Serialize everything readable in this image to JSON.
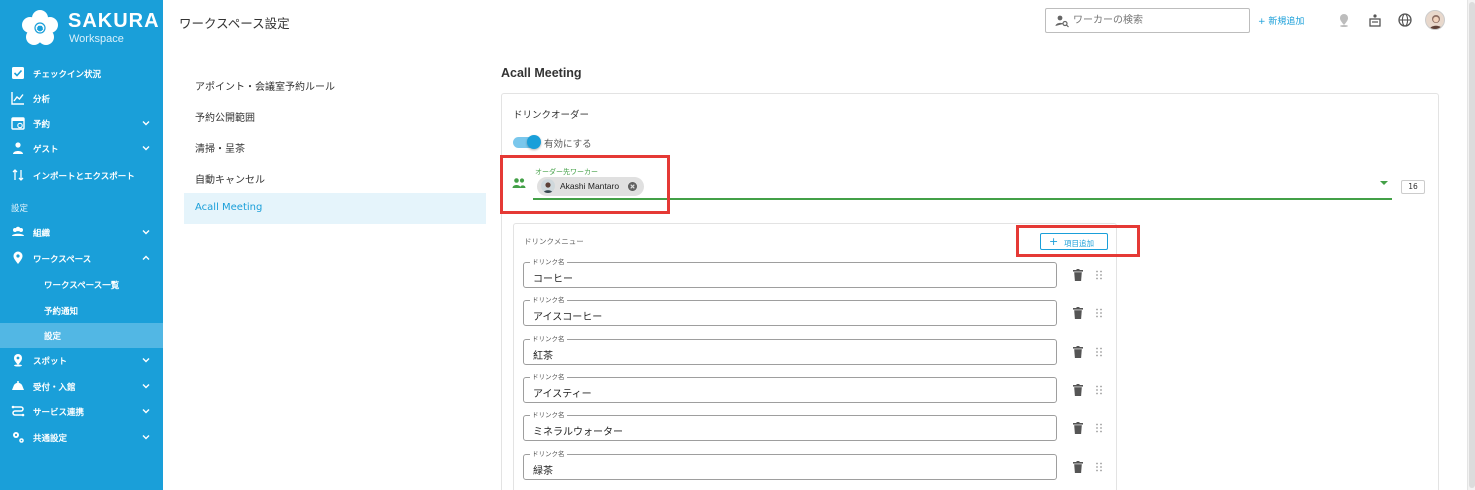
{
  "brand": {
    "name": "SAKURA",
    "sub": "Workspace"
  },
  "header": {
    "title": "ワークスペース設定",
    "search_placeholder": "ワーカーの検索",
    "new_add": "+ 新規追加"
  },
  "sidebar": {
    "items": [
      {
        "label": "チェックイン状況",
        "icon": "checkbox-icon"
      },
      {
        "label": "分析",
        "icon": "chart-icon"
      },
      {
        "label": "予約",
        "icon": "calendar-icon"
      },
      {
        "label": "ゲスト",
        "icon": "guest-icon"
      },
      {
        "label": "インポートとエクスポート",
        "icon": "import-export-icon"
      }
    ],
    "section_label": "設定",
    "settings_items": [
      {
        "label": "組織",
        "icon": "people-icon"
      },
      {
        "label": "ワークスペース",
        "icon": "location-pin-icon"
      }
    ],
    "sub_items": [
      {
        "label": "ワークスペース一覧"
      },
      {
        "label": "予約通知"
      },
      {
        "label": "設定"
      }
    ],
    "more_items": [
      {
        "label": "スポット",
        "icon": "spot-icon"
      },
      {
        "label": "受付・入館",
        "icon": "reception-icon"
      },
      {
        "label": "サービス連携",
        "icon": "integration-icon"
      },
      {
        "label": "共通設定",
        "icon": "gear-icon"
      }
    ]
  },
  "settings_menu": [
    {
      "label": "アポイント・会議室予約ルール"
    },
    {
      "label": "予約公開範囲"
    },
    {
      "label": "清掃・呈茶"
    },
    {
      "label": "自動キャンセル"
    },
    {
      "label": "Acall Meeting"
    }
  ],
  "main": {
    "section_title": "Acall Meeting",
    "drink_order": {
      "title": "ドリンクオーダー",
      "toggle_label": "有効にする",
      "toggle_on": true,
      "worker_field_label": "オーダー先ワーカー",
      "worker_chip": "Akashi Mantaro",
      "count": "16"
    },
    "drink_menu": {
      "title": "ドリンクメニュー",
      "add_button": "項目追加",
      "field_legend": "ドリンク名",
      "items": [
        "コーヒー",
        "アイスコーヒー",
        "紅茶",
        "アイスティー",
        "ミネラルウォーター",
        "緑茶"
      ]
    }
  },
  "colors": {
    "accent": "#1a9fd9",
    "green": "#43a047",
    "highlight": "#e53935"
  }
}
